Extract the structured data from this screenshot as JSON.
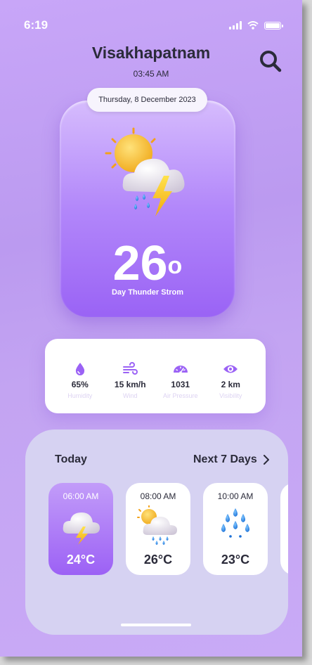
{
  "status": {
    "time": "6:19"
  },
  "header": {
    "city": "Visakhapatnam",
    "local_time": "03:45 AM"
  },
  "current": {
    "date": "Thursday, 8 December 2023",
    "temperature": "26",
    "degree_symbol": "o",
    "condition": "Day Thunder Strom",
    "icon": "sun-cloud-thunder-rain-icon"
  },
  "stats": [
    {
      "icon": "drop-icon",
      "value": "65%",
      "label": "Humidity"
    },
    {
      "icon": "wind-icon",
      "value": "15 km/h",
      "label": "Wind"
    },
    {
      "icon": "gauge-icon",
      "value": "1031",
      "label": "Air Pressure"
    },
    {
      "icon": "eye-icon",
      "value": "2 km",
      "label": "Visibility"
    }
  ],
  "forecast": {
    "today_label": "Today",
    "next_label": "Next 7 Days",
    "hours": [
      {
        "time": "06:00 AM",
        "temp": "24°C",
        "icon": "cloud-thunder-icon",
        "active": true
      },
      {
        "time": "08:00 AM",
        "temp": "26°C",
        "icon": "sun-cloud-rain-icon",
        "active": false
      },
      {
        "time": "10:00 AM",
        "temp": "23°C",
        "icon": "rain-drops-icon",
        "active": false
      }
    ]
  },
  "colors": {
    "accent": "#9b62f5",
    "background": "#c4a4f4",
    "text": "#2b2b3a"
  }
}
